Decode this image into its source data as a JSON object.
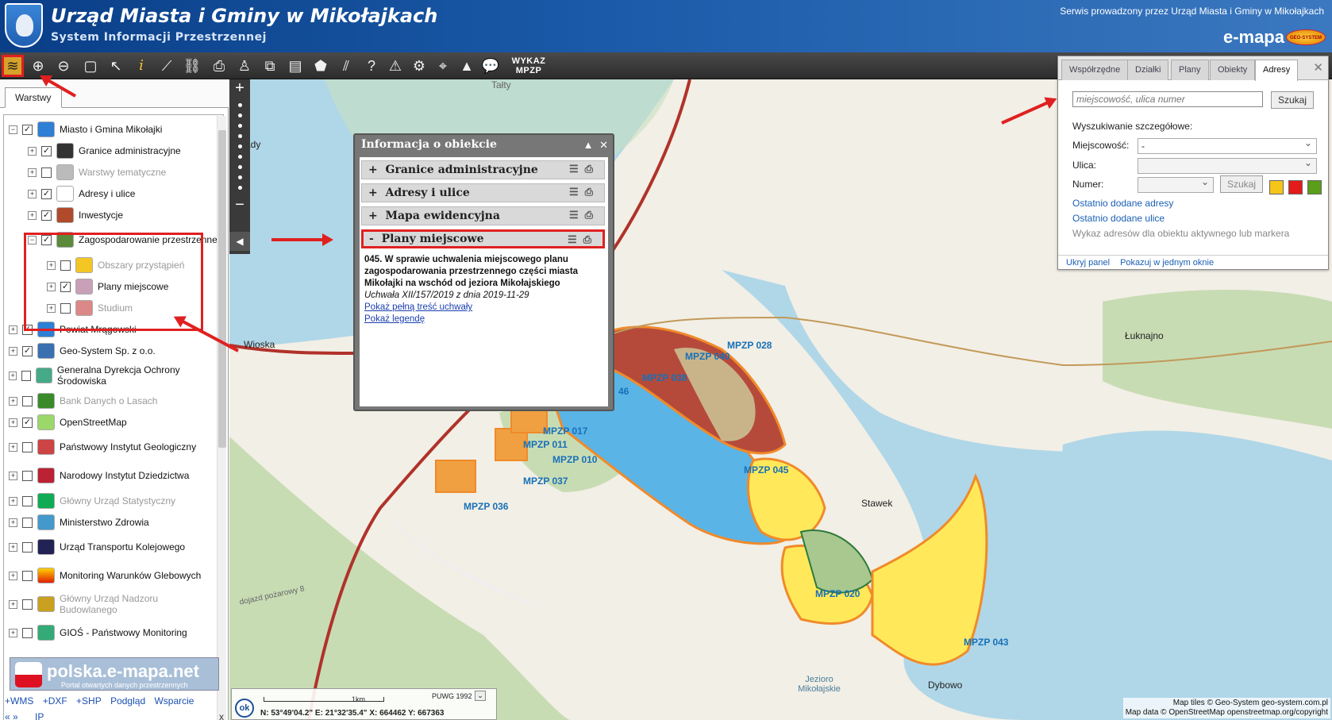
{
  "header": {
    "title": "Urząd Miasta i Gminy w Mikołajkach",
    "subtitle": "System Informacji Przestrzennej",
    "service": "Serwis prowadzony przez Urząd Miasta i Gminy w Mikołajkach",
    "brand": "e-mapa",
    "logo_text": "GEO-SYSTEM"
  },
  "toolbar": {
    "wykaz": "WYKAZ",
    "mpzp": "MPZP"
  },
  "leftpanel": {
    "tab": "Warstwy",
    "tree": [
      {
        "label": "Miasto i Gmina Mikołajki",
        "checked": true,
        "level": 0,
        "expanded": true
      },
      {
        "label": "Granice administracyjne",
        "checked": true,
        "level": 1
      },
      {
        "label": "Warstwy tematyczne",
        "checked": false,
        "level": 1,
        "disabled": true
      },
      {
        "label": "Adresy i ulice",
        "checked": true,
        "level": 1
      },
      {
        "label": "Inwestycje",
        "checked": true,
        "level": 1
      },
      {
        "label": "Zagospodarowanie przestrzenne",
        "checked": true,
        "level": 1,
        "expanded": true
      },
      {
        "label": "Obszary przystąpień",
        "checked": false,
        "level": 2,
        "disabled": true
      },
      {
        "label": "Plany miejscowe",
        "checked": true,
        "level": 2
      },
      {
        "label": "Studium",
        "checked": false,
        "level": 2,
        "disabled": true
      },
      {
        "label": "Powiat Mrągowski",
        "checked": true,
        "level": 0
      },
      {
        "label": "Geo-System Sp. z o.o.",
        "checked": true,
        "level": 0
      },
      {
        "label": "Generalna Dyrekcja Ochrony Środowiska",
        "checked": false,
        "level": 0
      },
      {
        "label": "Bank Danych o Lasach",
        "checked": false,
        "level": 0,
        "disabled": true
      },
      {
        "label": "OpenStreetMap",
        "checked": true,
        "level": 0
      },
      {
        "label": "Państwowy Instytut Geologiczny",
        "checked": false,
        "level": 0
      },
      {
        "label": "Narodowy Instytut Dziedzictwa",
        "checked": false,
        "level": 0
      },
      {
        "label": "Główny Urząd Statystyczny",
        "checked": false,
        "level": 0,
        "disabled": true
      },
      {
        "label": "Ministerstwo Zdrowia",
        "checked": false,
        "level": 0
      },
      {
        "label": "Urząd Transportu Kolejowego",
        "checked": false,
        "level": 0
      },
      {
        "label": "Monitoring Warunków Glebowych",
        "checked": false,
        "level": 0
      },
      {
        "label": "Główny Urząd Nadzoru Budowlanego",
        "checked": false,
        "level": 0,
        "disabled": true
      },
      {
        "label": "GIOŚ - Państwowy Monitoring",
        "checked": false,
        "level": 0
      }
    ],
    "polska_name": "polska.e-mapa.net",
    "polska_sub": "Portal otwartych danych przestrzennych",
    "links": [
      "+WMS",
      "+DXF",
      "+SHP",
      "Podgląd",
      "Wsparcie"
    ],
    "nav_left": "« »",
    "nav_ip": "IP",
    "nav_close": "x"
  },
  "popup": {
    "title": "Informacja o obiekcie",
    "sections": [
      {
        "sign": "+",
        "label": "Granice administracyjne"
      },
      {
        "sign": "+",
        "label": "Adresy i ulice"
      },
      {
        "sign": "+",
        "label": "Mapa ewidencyjna"
      },
      {
        "sign": "-",
        "label": "Plany miejscowe"
      }
    ],
    "plan_title": "045. W sprawie uchwalenia miejscowego planu zagospodarowania przestrzennego części miasta Mikołajki na wschód od jeziora Mikołajskiego",
    "plan_resolution": "Uchwała XII/157/2019 z dnia 2019-11-29",
    "link_full": "Pokaż pełną treść uchwały",
    "link_legend": "Pokaż legendę"
  },
  "search": {
    "tabs": [
      "Współrzędne",
      "Działki",
      "Plany",
      "Obiekty",
      "Adresy"
    ],
    "active_tab": "Adresy",
    "placeholder": "miejscowość, ulica numer",
    "search_btn": "Szukaj",
    "detailed": "Wyszukiwanie szczegółowe:",
    "miejscowosc_label": "Miejscowość:",
    "miejscowosc_value": "-",
    "ulica_label": "Ulica:",
    "numer_label": "Numer:",
    "numer_btn": "Szukaj",
    "swatches": [
      "#f5c518",
      "#e41b1b",
      "#5a9e1a"
    ],
    "link_adresy": "Ostatnio dodane adresy",
    "link_ulice": "Ostatnio dodane ulice",
    "note": "Wykaz adresów dla obiektu aktywnego lub markera",
    "footer_hide": "Ukryj panel",
    "footer_one": "Pokazuj w jednym oknie"
  },
  "map": {
    "places": [
      "Sady",
      "Tałty",
      "Wioska",
      "Łuknajno",
      "Stawek",
      "Dybowo",
      "Jezioro Mikołajskie",
      "dojazd pożarowy 8"
    ],
    "plans": [
      "MPZP 028",
      "MPZP 040",
      "MPZP 038",
      "MPZP 017",
      "MPZP 011",
      "MPZP 010",
      "MPZP 037",
      "MPZP 036",
      "MPZP 045",
      "MPZP 020",
      "MPZP 043",
      "46"
    ],
    "scale_label": "1km",
    "crs": "PUWG 1992",
    "coords": "N: 53°49'04.2\"   E: 21°32'35.4\"   X: 664462        Y: 667363",
    "attribution_1": "Map tiles © Geo-System geo-system.com.pl",
    "attribution_2": "Map data © OpenStreetMap openstreetmap.org/copyright"
  }
}
